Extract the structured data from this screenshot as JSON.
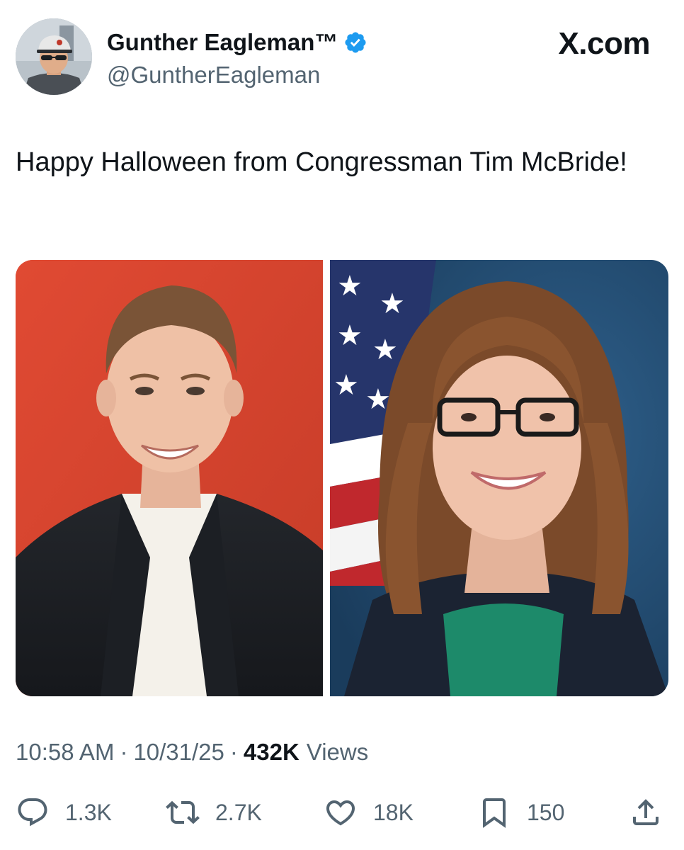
{
  "author": {
    "display_name": "Gunther Eagleman™",
    "handle": "@GuntherEagleman",
    "avatar_icon": "avatar-photo",
    "verified_icon": "verified-badge-icon",
    "verified_color": "#1d9bf0"
  },
  "brand": "X.com",
  "tweet": {
    "text": "Happy Halloween from Congressman Tim McBride!"
  },
  "media": [
    {
      "description_icon": "photo-young-man-red-background"
    },
    {
      "description_icon": "photo-woman-glasses-flag-background"
    }
  ],
  "meta": {
    "time": "10:58 AM",
    "separator": "·",
    "date": "10/31/25",
    "views_count": "432K",
    "views_label": "Views"
  },
  "actions": {
    "reply_count": "1.3K",
    "repost_count": "2.7K",
    "like_count": "18K",
    "bookmark_count": "150"
  },
  "colors": {
    "text_primary": "#0f1419",
    "text_secondary": "#536471",
    "accent": "#1d9bf0"
  }
}
